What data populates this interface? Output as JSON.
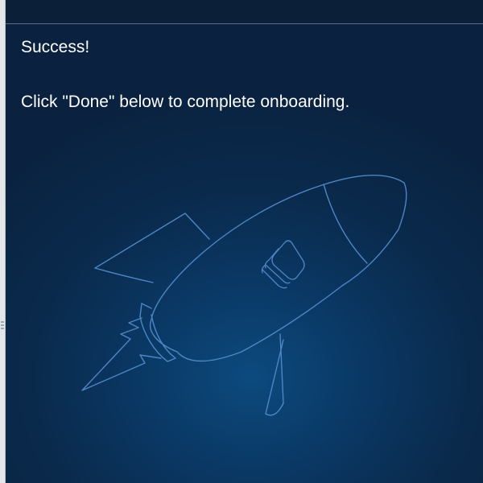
{
  "dialog": {
    "headline": "Success!",
    "message": "Click \"Done\" below to complete onboarding."
  },
  "illustration": {
    "icon": "rocket-icon",
    "stroke_color": "#4d86c4"
  },
  "colors": {
    "background_center": "#0c4a7e",
    "background_edge": "#0a2240",
    "text": "#ffffff"
  }
}
